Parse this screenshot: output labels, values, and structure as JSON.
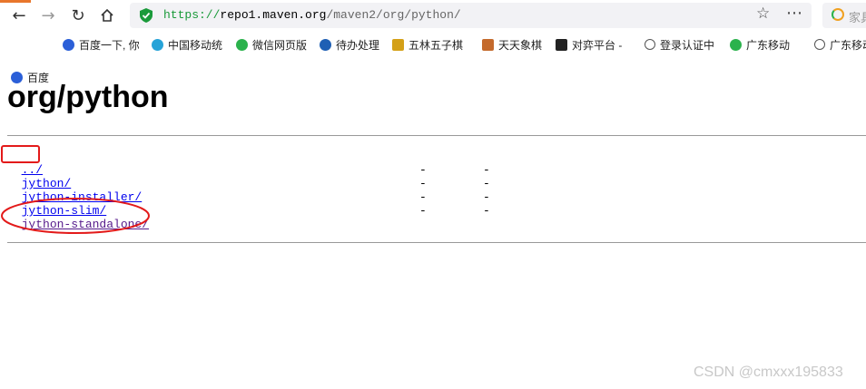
{
  "browser": {
    "url_scheme": "https://",
    "url_host": "repo1.maven.org",
    "url_path": "/maven2/org/python/",
    "search_placeholder": "家具"
  },
  "bookmarks": [
    {
      "label": "百度",
      "color": "#2b5fd8"
    },
    {
      "label": "百度一下, 你",
      "color": "#2b5fd8"
    },
    {
      "label": "中国移动统",
      "color": "#27a3d8"
    },
    {
      "label": "微信网页版",
      "color": "#2bb24c"
    },
    {
      "label": "待办处理",
      "color": "#1e5fb4"
    },
    {
      "label": "五林五子棋",
      "color": "#d4a017"
    },
    {
      "label": "天天象棋",
      "color": "#c46a2c"
    },
    {
      "label": "对弈平台 -",
      "color": "#222222"
    },
    {
      "label": "登录认证中",
      "color": "#555555"
    },
    {
      "label": "广东移动",
      "color": "#2bb24c"
    },
    {
      "label": "广东移动",
      "color": "#555555"
    }
  ],
  "page": {
    "title": "org/python",
    "entries": [
      {
        "name": "../",
        "date": "",
        "size": ""
      },
      {
        "name": "jython/",
        "date": "-",
        "size": "-"
      },
      {
        "name": "jython-installer/",
        "date": "-",
        "size": "-"
      },
      {
        "name": "jython-slim/",
        "date": "-",
        "size": "-"
      },
      {
        "name": "jython-standalone/",
        "date": "-",
        "size": "-"
      }
    ]
  },
  "watermark": "CSDN @cmxxx195833",
  "colors": {
    "link": "#0000ee",
    "visited_link": "#551a8b",
    "annotation": "#e31a1a",
    "secure_green": "#1a9a3a"
  }
}
